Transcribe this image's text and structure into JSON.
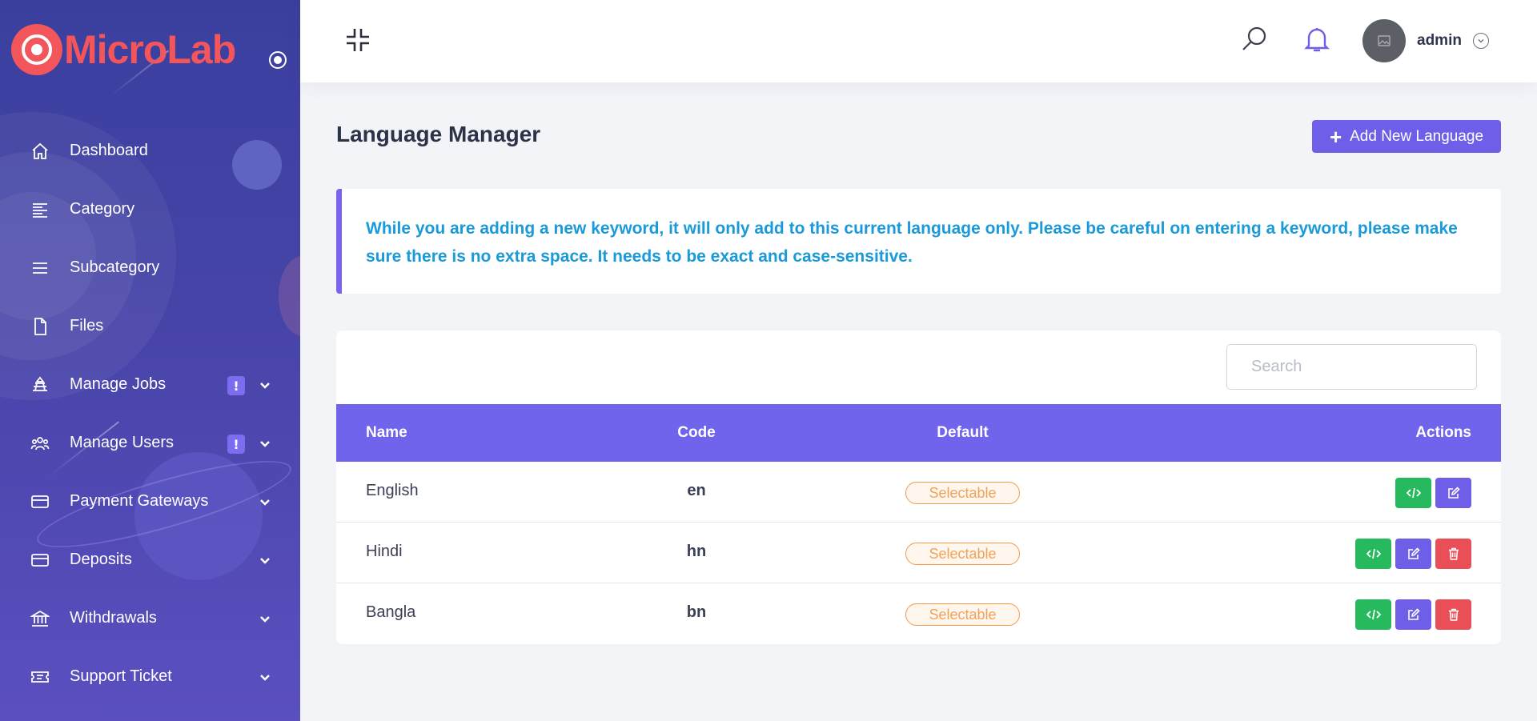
{
  "brand": {
    "name": "MicroLab"
  },
  "sidebar": {
    "items": [
      {
        "label": "Dashboard",
        "icon": "home-icon"
      },
      {
        "label": "Category",
        "icon": "category-lines-icon"
      },
      {
        "label": "Subcategory",
        "icon": "menu-lines-icon"
      },
      {
        "label": "Files",
        "icon": "file-icon"
      },
      {
        "label": "Manage Jobs",
        "icon": "jobs-icon",
        "badge": "!",
        "has_submenu": true
      },
      {
        "label": "Manage Users",
        "icon": "users-icon",
        "badge": "!",
        "has_submenu": true
      },
      {
        "label": "Payment Gateways",
        "icon": "credit-card-icon",
        "has_submenu": true
      },
      {
        "label": "Deposits",
        "icon": "credit-card-icon",
        "has_submenu": true
      },
      {
        "label": "Withdrawals",
        "icon": "bank-icon",
        "has_submenu": true
      },
      {
        "label": "Support Ticket",
        "icon": "ticket-icon",
        "has_submenu": true
      }
    ]
  },
  "topbar": {
    "user_name": "admin"
  },
  "page": {
    "title": "Language Manager",
    "add_button_label": "Add New Language",
    "notice": "While you are adding a new keyword, it will only add to this current language only. Please be careful on entering a keyword, please make sure there is no extra space. It needs to be exact and case-sensitive."
  },
  "table": {
    "search_placeholder": "Search",
    "columns": {
      "name": "Name",
      "code": "Code",
      "default": "Default",
      "actions": "Actions"
    },
    "rows": [
      {
        "name": "English",
        "code": "en",
        "default": "Selectable",
        "deletable": false
      },
      {
        "name": "Hindi",
        "code": "hn",
        "default": "Selectable",
        "deletable": true
      },
      {
        "name": "Bangla",
        "code": "bn",
        "default": "Selectable",
        "deletable": true
      }
    ]
  },
  "colors": {
    "accent": "#6f5fe8",
    "brand": "#f2555a",
    "notice_text": "#1a9ad9",
    "success": "#27b95e",
    "danger": "#ea4e56",
    "badge_warning": "#f19a4a"
  }
}
